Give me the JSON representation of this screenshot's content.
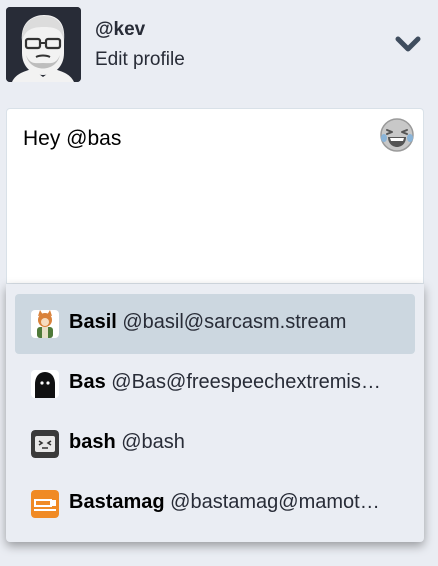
{
  "profile": {
    "handle": "@kev",
    "edit_label": "Edit profile",
    "menu_icon": "chevron-down-icon"
  },
  "compose": {
    "text": "Hey @bas",
    "emoji_icon": "laughing-emoji-icon"
  },
  "suggestions": [
    {
      "name": "Basil",
      "acct": "@basil@sarcasm.stream",
      "selected": true
    },
    {
      "name": "Bas",
      "acct": "@Bas@freespeechextremis…",
      "selected": false
    },
    {
      "name": "bash",
      "acct": "@bash",
      "selected": false
    },
    {
      "name": "Bastamag",
      "acct": "@bastamag@mamot…",
      "selected": false
    }
  ],
  "colors": {
    "background": "#eaedf3",
    "selected_row": "#ccd7e0",
    "avatar_bg": "#282c37",
    "chevron": "#3f4d5e"
  }
}
